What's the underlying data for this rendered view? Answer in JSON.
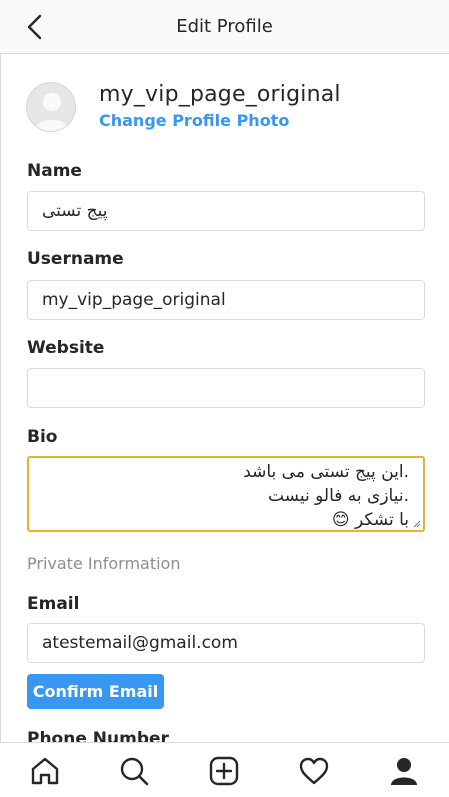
{
  "header": {
    "title": "Edit Profile",
    "back_icon": "chevron-left-icon"
  },
  "profile": {
    "username": "my_vip_page_original",
    "change_photo_label": "Change Profile Photo"
  },
  "fields": {
    "name": {
      "label": "Name",
      "value": "پیج تستی"
    },
    "username": {
      "label": "Username",
      "value": "my_vip_page_original"
    },
    "website": {
      "label": "Website",
      "value": ""
    },
    "bio": {
      "label": "Bio",
      "lines": [
        ".این پیج تستی می باشد",
        ".نیازی به فالو نیست",
        "با تشکر 😊"
      ]
    }
  },
  "private": {
    "section_title": "Private Information",
    "email": {
      "label": "Email",
      "value": "atestemail@gmail.com"
    },
    "confirm_label": "Confirm Email",
    "phone_label": "Phone Number"
  },
  "bottom_nav": [
    "home-icon",
    "search-icon",
    "new-post-icon",
    "activity-heart-icon",
    "profile-icon"
  ],
  "colors": {
    "accent": "#3897f0",
    "focus_border": "#e6b230",
    "border": "#dbdbdb",
    "muted": "#8e8e8e"
  }
}
